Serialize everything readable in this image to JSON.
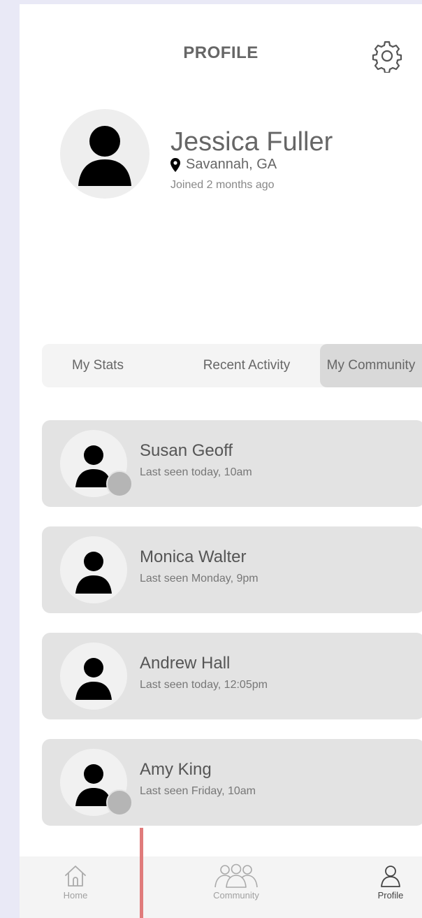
{
  "header": {
    "title": "PROFILE",
    "settings_icon": "gear-icon"
  },
  "profile": {
    "name": "Jessica Fuller",
    "location": "Savannah, GA",
    "joined": "Joined 2 months ago"
  },
  "tabs": [
    {
      "label": "My Stats",
      "active": false
    },
    {
      "label": "Recent Activity",
      "active": false
    },
    {
      "label": "My Community",
      "active": true
    }
  ],
  "community": [
    {
      "name": "Susan Geoff",
      "last_seen": "Last seen today, 10am",
      "presence": true
    },
    {
      "name": "Monica Walter",
      "last_seen": "Last seen Monday, 9pm",
      "presence": false
    },
    {
      "name": "Andrew Hall",
      "last_seen": "Last seen today, 12:05pm",
      "presence": false
    },
    {
      "name": "Amy King",
      "last_seen": "Last seen Friday, 10am",
      "presence": true
    }
  ],
  "nav": [
    {
      "label": "Home",
      "icon": "home-icon",
      "active": false
    },
    {
      "label": "Community",
      "icon": "community-icon",
      "active": false
    },
    {
      "label": "Profile",
      "icon": "profile-icon",
      "active": true
    }
  ],
  "colors": {
    "background": "#e9e9f6",
    "card": "#e3e3e3",
    "active_tab": "#d9d9d9",
    "presence_dot": "#b5b5b5",
    "scroll_indicator": "#e07b7b"
  }
}
